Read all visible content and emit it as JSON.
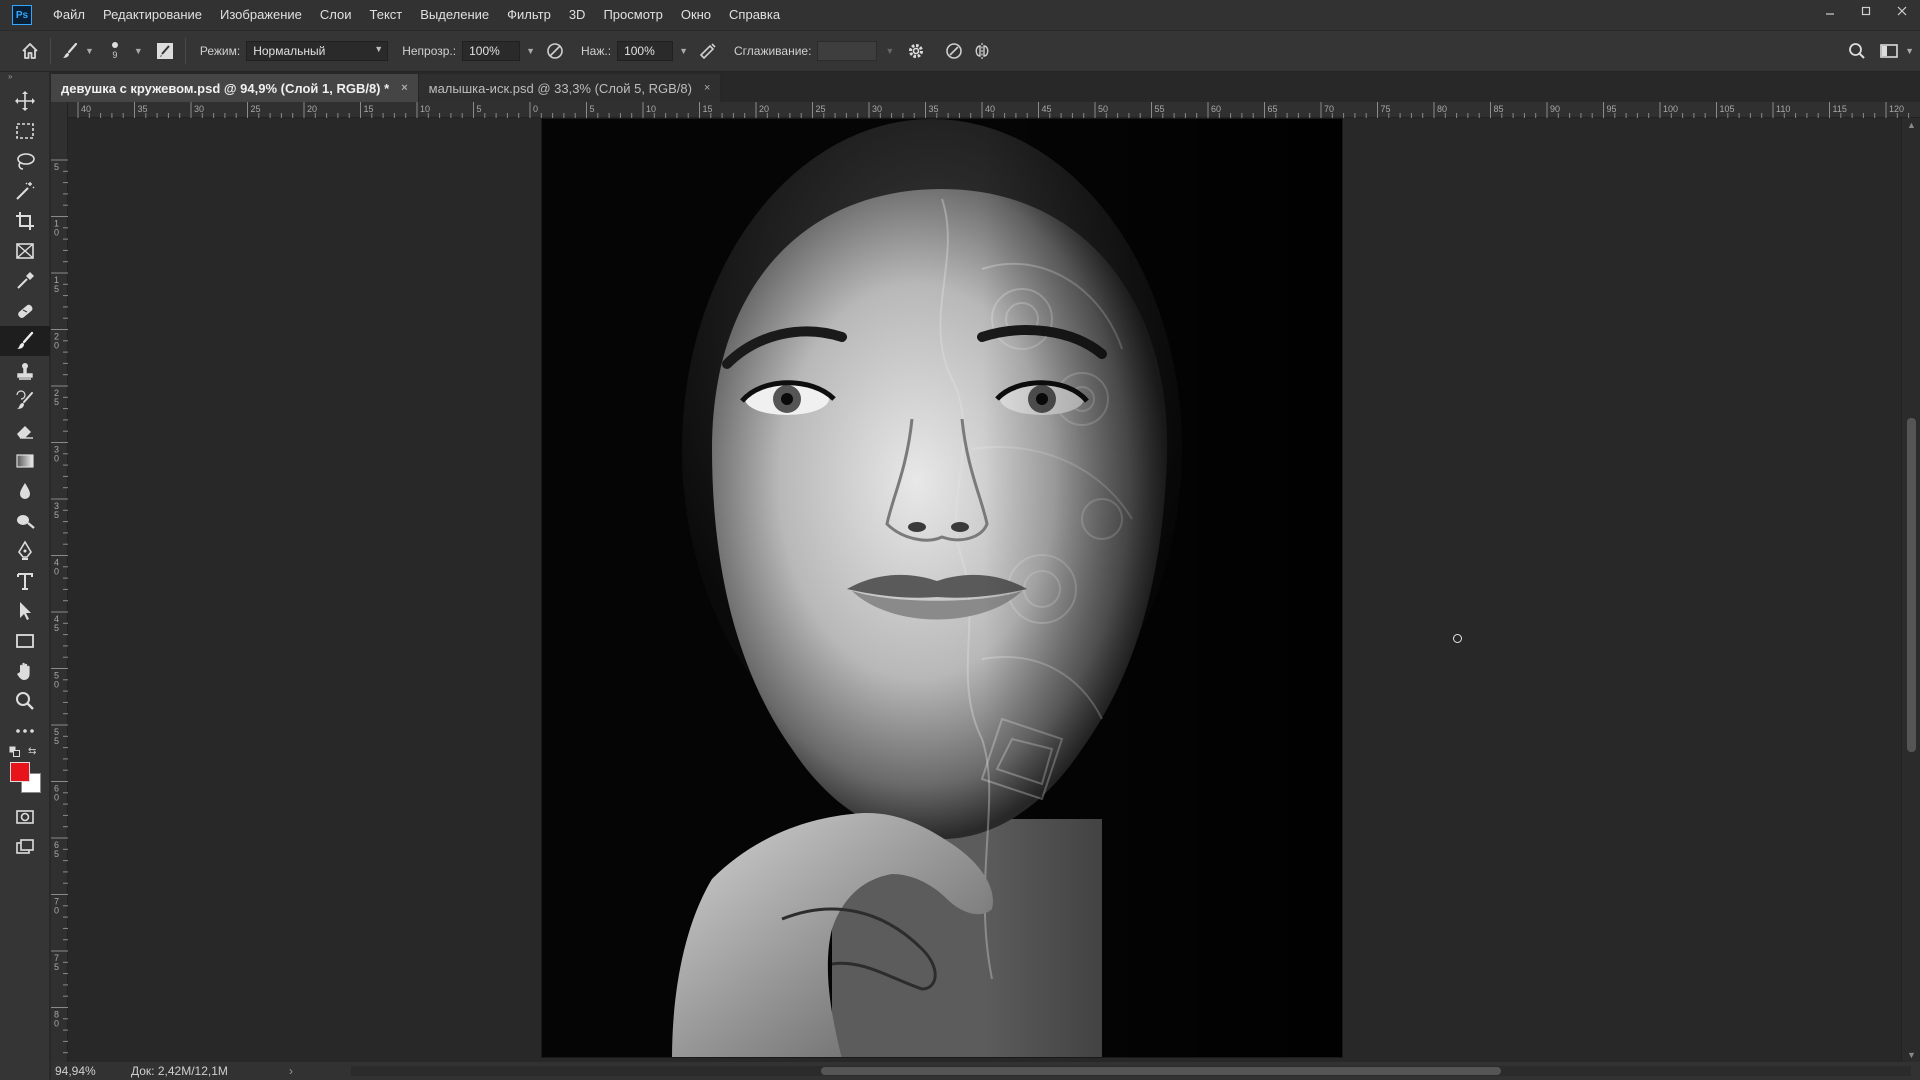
{
  "app": {
    "logo_text": "Ps",
    "menu": [
      "Файл",
      "Редактирование",
      "Изображение",
      "Слои",
      "Текст",
      "Выделение",
      "Фильтр",
      "3D",
      "Просмотр",
      "Окно",
      "Справка"
    ],
    "window_controls": [
      "minimize-icon",
      "maximize-icon",
      "close-icon"
    ]
  },
  "options": {
    "brush_size": "9",
    "mode_label": "Режим:",
    "mode_value": "Нормальный",
    "opacity_label": "Непрозр.:",
    "opacity_value": "100%",
    "flow_label": "Наж.:",
    "flow_value": "100%",
    "smoothing_label": "Сглаживание:"
  },
  "tabs": [
    {
      "label": "девушка с кружевом.psd @ 94,9% (Слой 1, RGB/8) *",
      "active": true
    },
    {
      "label": "малышка-иск.psd @ 33,3% (Слой 5, RGB/8)",
      "active": false
    }
  ],
  "tab_close_glyph": "×",
  "ruler": {
    "h_labels": [
      "40",
      "35",
      "30",
      "25",
      "20",
      "15",
      "10",
      "5",
      "0",
      "5",
      "10",
      "15",
      "20",
      "25",
      "30",
      "35",
      "40",
      "45",
      "50",
      "55",
      "60",
      "65",
      "70",
      "75",
      "80",
      "85",
      "90",
      "95",
      "100",
      "105",
      "110",
      "115",
      "120"
    ],
    "v_labels": [
      "5",
      "1 0",
      "1 5",
      "2 0",
      "2 5",
      "3 0",
      "3 5",
      "4 0",
      "4 5",
      "5 0",
      "5 5",
      "6 0",
      "6 5",
      "7 0",
      "7 5",
      "8 0"
    ]
  },
  "colors": {
    "foreground": "#e8141b",
    "background": "#ffffff",
    "accent": "#31a8ff"
  },
  "tools": [
    "move-tool-icon",
    "marquee-tool-icon",
    "lasso-tool-icon",
    "magic-wand-tool-icon",
    "crop-tool-icon",
    "frame-tool-icon",
    "eyedropper-tool-icon",
    "healing-brush-tool-icon",
    "brush-tool-icon",
    "clone-stamp-tool-icon",
    "history-brush-tool-icon",
    "eraser-tool-icon",
    "gradient-tool-icon",
    "blur-tool-icon",
    "dodge-tool-icon",
    "pen-tool-icon",
    "type-tool-icon",
    "path-selection-tool-icon",
    "rectangle-tool-icon",
    "hand-tool-icon",
    "zoom-tool-icon",
    "more-tools-icon"
  ],
  "status": {
    "zoom": "94,94%",
    "doc": "Док: 2,42M/12,1M"
  }
}
